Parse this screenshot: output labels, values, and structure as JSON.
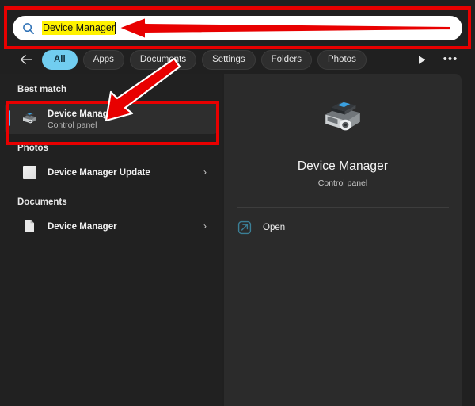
{
  "search": {
    "value": "Device Manager",
    "icon": "search-icon"
  },
  "filters": {
    "back_icon": "back-arrow-icon",
    "tabs": [
      {
        "label": "All",
        "active": true
      },
      {
        "label": "Apps",
        "active": false
      },
      {
        "label": "Documents",
        "active": false
      },
      {
        "label": "Settings",
        "active": false
      },
      {
        "label": "Folders",
        "active": false
      },
      {
        "label": "Photos",
        "active": false
      }
    ],
    "play_icon": "play-triangle-icon",
    "more_label": "•••"
  },
  "results": {
    "best_match": {
      "heading": "Best match",
      "title": "Device Manager",
      "subtitle": "Control panel",
      "icon": "device-manager-icon"
    },
    "photos": {
      "heading": "Photos",
      "items": [
        {
          "title": "Device Manager Update",
          "icon": "photo-thumbnail-icon",
          "chevron": "›"
        }
      ]
    },
    "documents": {
      "heading": "Documents",
      "items": [
        {
          "title": "Device Manager",
          "icon": "document-icon",
          "chevron": "›"
        }
      ]
    }
  },
  "preview": {
    "icon": "device-manager-icon",
    "title": "Device Manager",
    "subtitle": "Control panel",
    "actions": [
      {
        "label": "Open",
        "icon": "open-external-icon"
      }
    ]
  },
  "annotations": {
    "accent_color": "#e80000",
    "highlight_color": "#fff200",
    "selection_color": "#4cc2ff"
  }
}
